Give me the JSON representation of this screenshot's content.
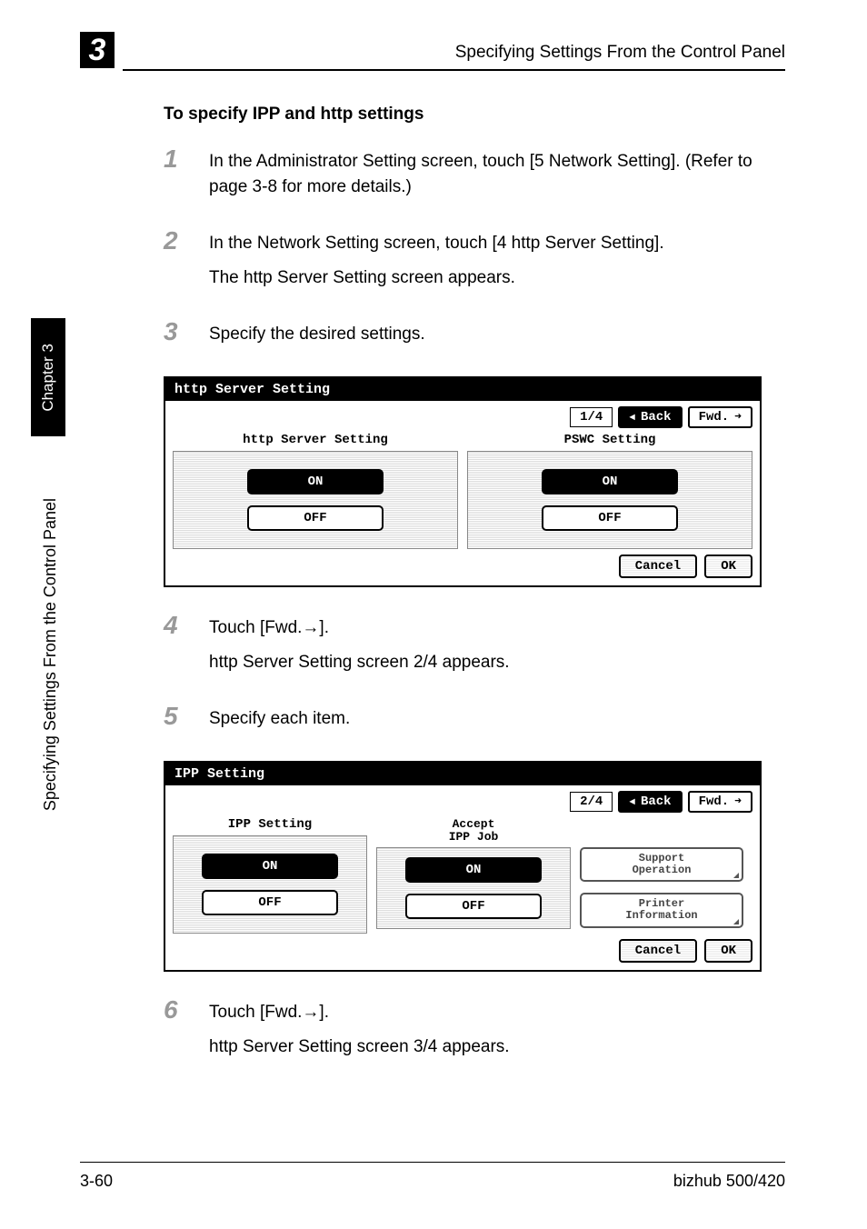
{
  "chapter_badge": "3",
  "header_title": "Specifying Settings From the Control Panel",
  "sidebar_tab": "Chapter 3",
  "sidebar_text": "Specifying Settings From the Control Panel",
  "section_heading": "To specify IPP and http settings",
  "steps": {
    "s1": {
      "num": "1",
      "text": "In the Administrator Setting screen, touch [5 Network Setting]. (Refer to page 3-8 for more details.)"
    },
    "s2": {
      "num": "2",
      "line1": "In the Network Setting screen, touch [4 http Server Setting].",
      "line2": "The http Server Setting screen appears."
    },
    "s3": {
      "num": "3",
      "text": "Specify the desired settings."
    },
    "s4": {
      "num": "4",
      "line1": "Touch [Fwd.→].",
      "line2": "http Server Setting screen 2/4 appears."
    },
    "s5": {
      "num": "5",
      "text": "Specify each item."
    },
    "s6": {
      "num": "6",
      "line1": "Touch [Fwd.→].",
      "line2": "http Server Setting screen 3/4 appears."
    }
  },
  "screen1": {
    "title": "http Server Setting",
    "pager": "1/4",
    "back": "Back",
    "fwd": "Fwd.",
    "panel1_title": "http Server Setting",
    "panel2_title": "PSWC Setting",
    "on": "ON",
    "off": "OFF",
    "cancel": "Cancel",
    "ok": "OK"
  },
  "screen2": {
    "title": "IPP Setting",
    "pager": "2/4",
    "back": "Back",
    "fwd": "Fwd.",
    "panel1_title": "IPP Setting",
    "panel2_title_l1": "Accept",
    "panel2_title_l2": "IPP Job",
    "on": "ON",
    "off": "OFF",
    "side1_l1": "Support",
    "side1_l2": "Operation",
    "side2_l1": "Printer",
    "side2_l2": "Information",
    "cancel": "Cancel",
    "ok": "OK"
  },
  "footer_left": "3-60",
  "footer_right": "bizhub 500/420"
}
